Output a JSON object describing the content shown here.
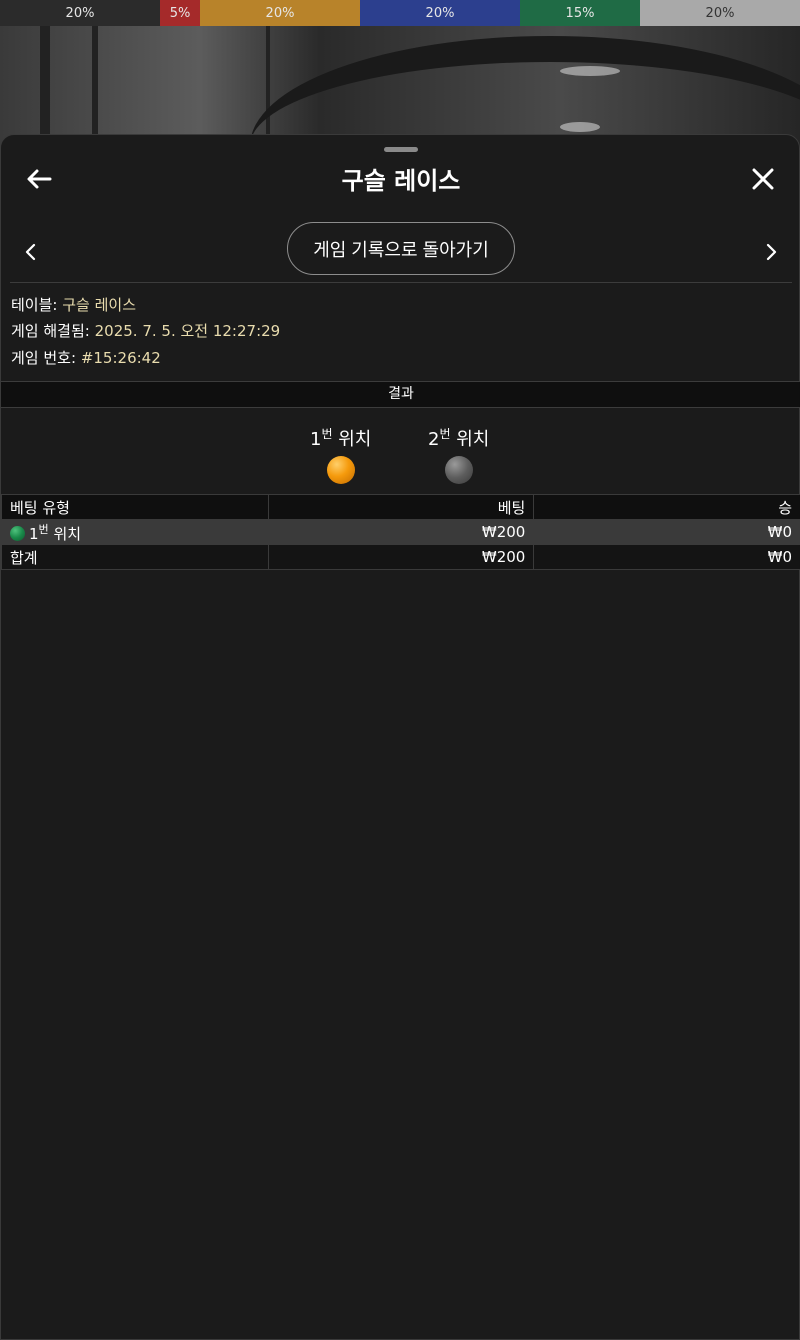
{
  "percent_bar": [
    {
      "label": "20%",
      "color": "#2b2b2b"
    },
    {
      "label": "5%",
      "color": "#a52a2a"
    },
    {
      "label": "20%",
      "color": "#b8832a"
    },
    {
      "label": "20%",
      "color": "#2c3f8e"
    },
    {
      "label": "15%",
      "color": "#1f6b45"
    },
    {
      "label": "20%",
      "color": "#a9a9a9"
    }
  ],
  "header": {
    "title": "구슬 레이스",
    "return_label": "게임 기록으로 돌아가기"
  },
  "info": {
    "table_label": "테이블:",
    "table_value": "구슬 레이스",
    "resolved_label": "게임 해결됨:",
    "resolved_value": "2025. 7. 5. 오전 12:27:29",
    "game_no_label": "게임 번호:",
    "game_no_value": "#15:26:42"
  },
  "result": {
    "section_label": "결과",
    "positions": [
      {
        "num": "1",
        "sup": "번",
        "text": "위치",
        "ball": "orange"
      },
      {
        "num": "2",
        "sup": "번",
        "text": "위치",
        "ball": "gray"
      }
    ]
  },
  "bets_table": {
    "headers": [
      "베팅 유형",
      "베팅",
      "승"
    ],
    "rows": [
      {
        "type_num": "1",
        "type_sup": "번",
        "type_text": "위치",
        "bet": "₩200",
        "win": "₩0"
      }
    ],
    "total": {
      "label": "합계",
      "bet": "₩200",
      "win": "₩0"
    }
  }
}
